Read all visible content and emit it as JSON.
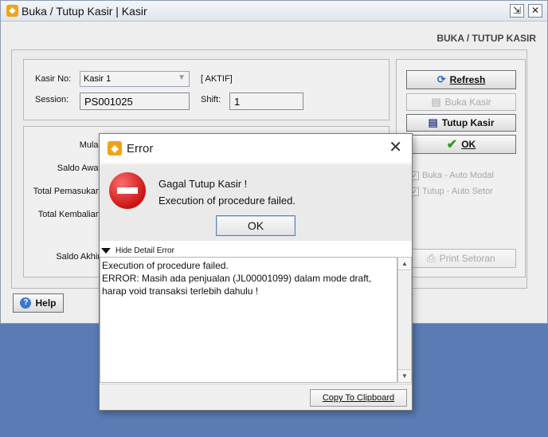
{
  "window": {
    "title": "Buka / Tutup Kasir | Kasir",
    "heading": "BUKA / TUTUP KASIR",
    "restore_glyph": "⇲",
    "close_glyph": "✕"
  },
  "form": {
    "kasir_no_label": "Kasir No:",
    "kasir_no_value": "Kasir 1",
    "status": "[ AKTIF]",
    "session_label": "Session:",
    "session_value": "PS001025",
    "shift_label": "Shift:",
    "shift_value": "1"
  },
  "summary": {
    "mulai": "Mulai",
    "saldo_awal": "Saldo Awal",
    "total_pemasukan": "Total Pemasukan",
    "total_kembalian": "Total Kembalian",
    "saldo_akhir": "Saldo Akhir"
  },
  "buttons": {
    "refresh": "Refresh",
    "buka_kasir": "Buka Kasir",
    "tutup_kasir": "Tutup Kasir",
    "ok": "OK",
    "print_setoran": "Print Setoran",
    "help": "Help"
  },
  "options": {
    "buka_auto_modal": "Buka - Auto Modal",
    "tutup_auto_setor": "Tutup - Auto Setor"
  },
  "dialog": {
    "title": "Error",
    "message_title": "Gagal Tutup Kasir !",
    "message_body": "Execution of procedure failed.",
    "ok": "OK",
    "hide_detail": "Hide Detail Error",
    "detail_line1": "Execution of procedure failed.",
    "detail_line2": "ERROR: Masih ada penjualan (JL00001099) dalam mode draft,",
    "detail_line3": "harap void transaksi terlebih dahulu !",
    "copy_clipboard": "Copy To Clipboard"
  },
  "colors": {
    "desktop": "#5a7bb4",
    "accent_orange": "#f0a319",
    "error_red": "#d01a1a",
    "ok_green": "#2e9a1f"
  }
}
